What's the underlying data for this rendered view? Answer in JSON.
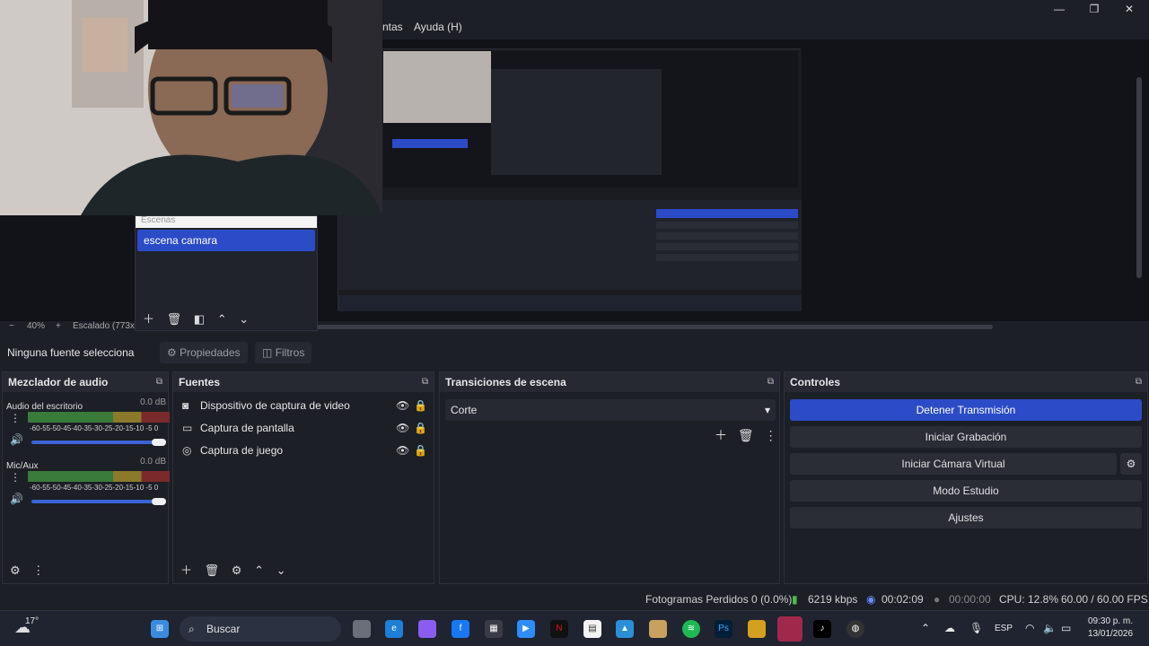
{
  "menu": {
    "partial_item": "ntas",
    "help": "Ayuda (H)"
  },
  "window_controls": {
    "minimize": "—",
    "maximize": "❐",
    "close": "✕"
  },
  "zoom": {
    "minus": "−",
    "value": "40%",
    "plus": "+",
    "scale_label": "Escalado (773x43"
  },
  "scenes": {
    "header": "Escenas",
    "items": [
      "escena camara"
    ]
  },
  "props_bar": {
    "no_source": "Ninguna fuente selecciona",
    "properties": "Propiedades",
    "filters": "Filtros"
  },
  "mixer": {
    "title": "Mezclador de audio",
    "channels": [
      {
        "name": "Audio del escritorio",
        "db": "0.0 dB",
        "ticks": "-60-55-50-45-40-35-30-25-20-15-10 -5  0",
        "level": 0.0
      },
      {
        "name": "Mic/Aux",
        "db": "0.0 dB",
        "ticks": "-60-55-50-45-40-35-30-25-20-15-10 -5  0",
        "level": 0.2
      }
    ]
  },
  "sources": {
    "title": "Fuentes",
    "items": [
      {
        "label": "Dispositivo de captura de video",
        "icon": "camera-icon"
      },
      {
        "label": "Captura de pantalla",
        "icon": "monitor-icon"
      },
      {
        "label": "Captura de juego",
        "icon": "gamepad-icon"
      }
    ]
  },
  "transitions": {
    "title": "Transiciones de escena",
    "selected": "Corte"
  },
  "controls": {
    "title": "Controles",
    "stop_stream": "Detener Transmisión",
    "start_record": "Iniciar Grabación",
    "start_virtualcam": "Iniciar Cámara Virtual",
    "studio_mode": "Modo Estudio",
    "settings": "Ajustes"
  },
  "status": {
    "dropped": "Fotogramas Perdidos 0 (0.0%)",
    "bitrate": "6219 kbps",
    "stream_time": "00:02:09",
    "rec_time": "00:00:00",
    "cpu": "CPU: 12.8%",
    "fps": "60.00 / 60.00 FPS"
  },
  "taskbar": {
    "weather": "17°",
    "search": "Buscar",
    "lang": "ESP",
    "time": "09:30 p. m.",
    "date": "13/01/2026"
  },
  "colors": {
    "accent": "#2c4bc7",
    "meter_green": "#3a7a3a",
    "meter_yellow": "#8a7a2a",
    "meter_red": "#7a2a2a"
  }
}
